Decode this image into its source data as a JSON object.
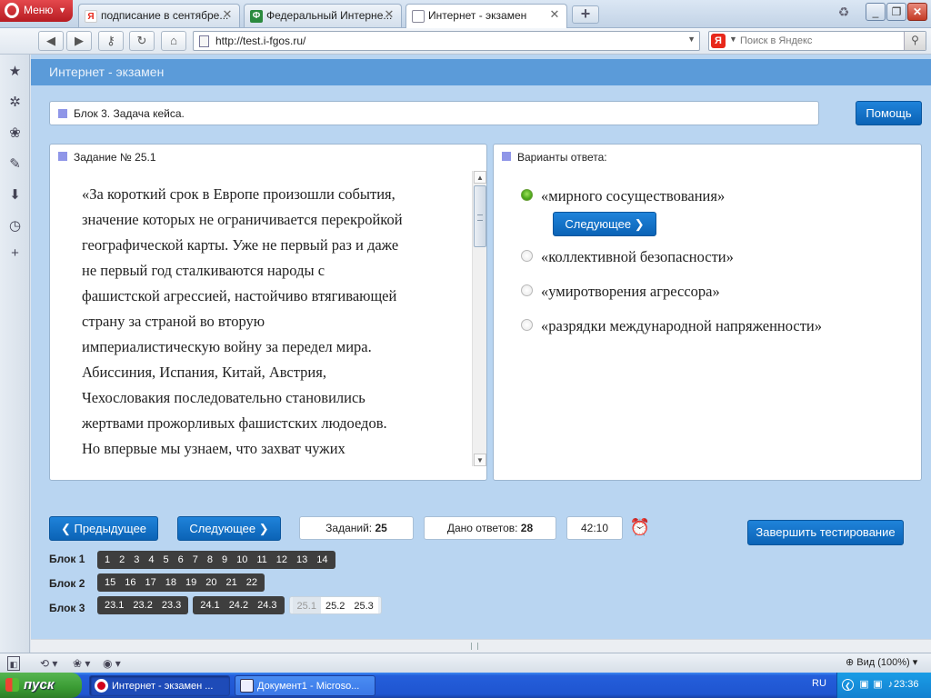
{
  "browser": {
    "menu_label": "Меню",
    "tabs": [
      {
        "label": "подписание в сентябре...",
        "icon": "yandex-icon"
      },
      {
        "label": "Федеральный Интерне...",
        "icon": "fi-icon"
      },
      {
        "label": "Интернет - экзамен",
        "icon": "page-icon",
        "active": true
      }
    ],
    "url": "http://test.i-fgos.ru/",
    "search_placeholder": "Поиск в Яндекс",
    "zoom_label": "Вид (100%)"
  },
  "page": {
    "header_title": "Интернет - экзамен",
    "block_title": "Блок 3. Задача кейса.",
    "help_label": "Помощь",
    "task_heading": "Задание № 25.1",
    "task_lines": [
      "«За короткий срок в Европе произошли события,",
      "значение которых не ограничивается перекройкой",
      "географической карты. Уже не первый раз и даже",
      "не первый год сталкиваются народы с",
      "фашистской агрессией, настойчиво втягивающей",
      "страну за страной во вторую",
      "империалистическую войну за передел мира.",
      "Абиссиния, Испания, Китай, Австрия,",
      "Чехословакия последовательно становились",
      "жертвами прожорливых фашистских людоедов.",
      "Но впервые мы узнаем, что захват чужих"
    ],
    "answers_heading": "Варианты ответа:",
    "answers": [
      {
        "text": "«мирного сосуществования»",
        "selected": true
      },
      {
        "text": "«коллективной безопасности»",
        "selected": false
      },
      {
        "text": "«умиротворения агрессора»",
        "selected": false
      },
      {
        "text": "«разрядки международной напряженности»",
        "selected": false
      }
    ],
    "inline_next_label": "Следующее",
    "prev_label": "Предыдущее",
    "next_label": "Следующее",
    "tasks_label": "Заданий:",
    "tasks_count": "25",
    "answered_label": "Дано ответов:",
    "answered_count": "28",
    "timer": "42:10",
    "finish_label": "Завершить тестирование",
    "blocks": [
      {
        "label": "Блок 1",
        "groups": [
          {
            "style": "dark",
            "items": [
              "1",
              "2",
              "3",
              "4",
              "5",
              "6",
              "7",
              "8",
              "9",
              "10",
              "11",
              "12",
              "13",
              "14"
            ]
          }
        ]
      },
      {
        "label": "Блок 2",
        "groups": [
          {
            "style": "dark",
            "items": [
              "15",
              "16",
              "17",
              "18",
              "19",
              "20",
              "21",
              "22"
            ]
          }
        ]
      },
      {
        "label": "Блок 3",
        "groups": [
          {
            "style": "dark",
            "items": [
              "23.1",
              "23.2",
              "23.3"
            ]
          },
          {
            "style": "dark",
            "items": [
              "24.1",
              "24.2",
              "24.3"
            ]
          },
          {
            "style": "light",
            "items": [
              "25.1",
              "25.2",
              "25.3"
            ]
          }
        ]
      }
    ]
  },
  "taskbar": {
    "start_label": "пуск",
    "tasks": [
      {
        "label": "Интернет - экзамен ...",
        "active": true
      },
      {
        "label": "Документ1 - Microso...",
        "active": false
      }
    ],
    "lang": "RU",
    "clock": "23:36"
  }
}
